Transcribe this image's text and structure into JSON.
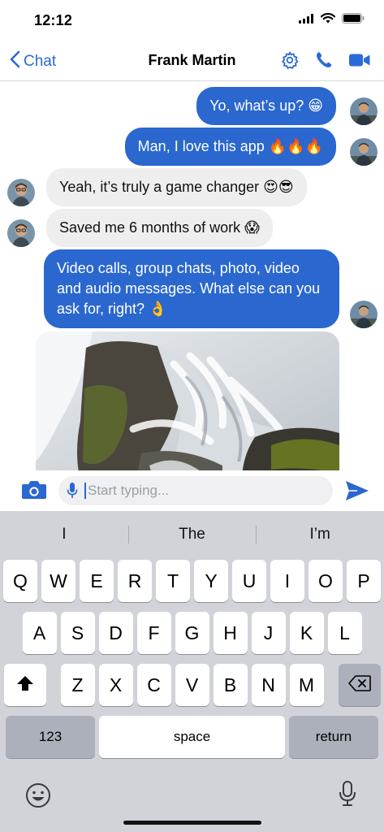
{
  "status": {
    "time": "12:12"
  },
  "nav": {
    "back_label": "Chat",
    "title": "Frank Martin"
  },
  "messages": [
    {
      "text": "Yo, what’s up? 😁",
      "direction": "outgoing"
    },
    {
      "text": "Man, I love this app 🔥🔥🔥",
      "direction": "outgoing"
    },
    {
      "text": "Yeah, it’s truly a game changer 😍😎",
      "direction": "incoming"
    },
    {
      "text": "Saved me 6 months of work 😱",
      "direction": "incoming"
    },
    {
      "text": "Video calls, group chats, photo, video and audio messages. What else can you ask for, right? 👌",
      "direction": "outgoing"
    }
  ],
  "image_message": {
    "subject": "waterfall-over-mossy-rocks"
  },
  "composer": {
    "placeholder": "Start typing..."
  },
  "keyboard": {
    "suggestions": [
      "I",
      "The",
      "I’m"
    ],
    "row1": [
      "Q",
      "W",
      "E",
      "R",
      "T",
      "Y",
      "U",
      "I",
      "O",
      "P"
    ],
    "row2": [
      "A",
      "S",
      "D",
      "F",
      "G",
      "H",
      "J",
      "K",
      "L"
    ],
    "row3": [
      "Z",
      "X",
      "C",
      "V",
      "B",
      "N",
      "M"
    ],
    "numbers_label": "123",
    "space_label": "space",
    "return_label": "return"
  },
  "colors": {
    "accent": "#2a67cf",
    "incoming_bubble": "#eeeeee",
    "keyboard_bg": "#d1d3d9"
  }
}
